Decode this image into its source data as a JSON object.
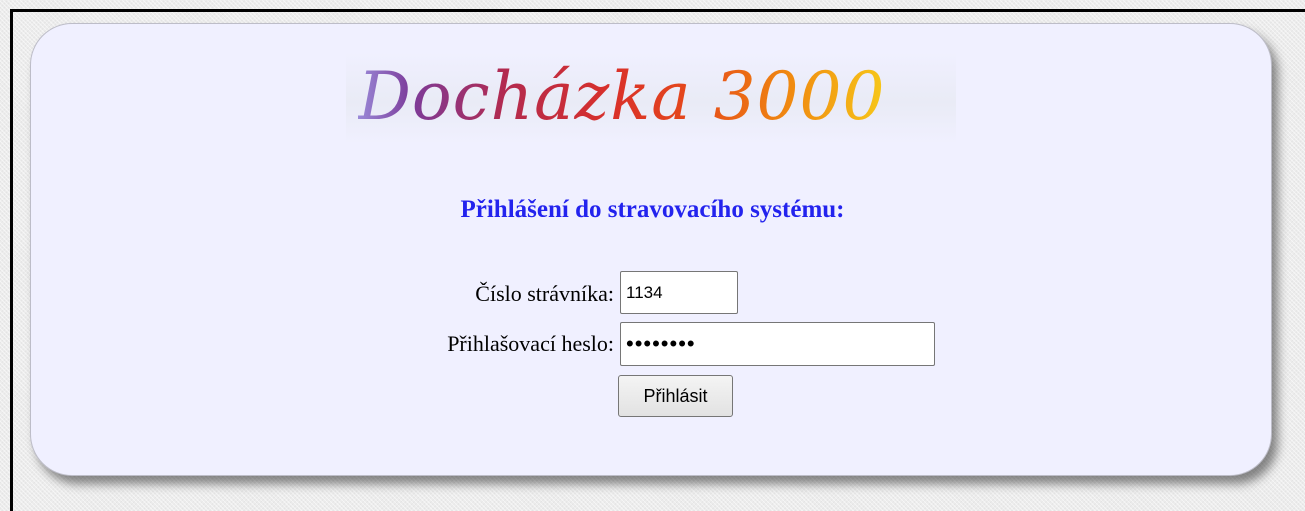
{
  "logo": {
    "text": "Docházka 3000"
  },
  "heading": "Přihlášení do stravovacího systému:",
  "form": {
    "number_label": "Číslo strávníka:",
    "number_value": "1134",
    "password_label": "Přihlašovací heslo:",
    "password_value": "••••••••",
    "submit_label": "Přihlásit"
  },
  "colors": {
    "card_background": "#f0f0ff",
    "heading": "#2323ee",
    "frame_border": "#000000"
  }
}
